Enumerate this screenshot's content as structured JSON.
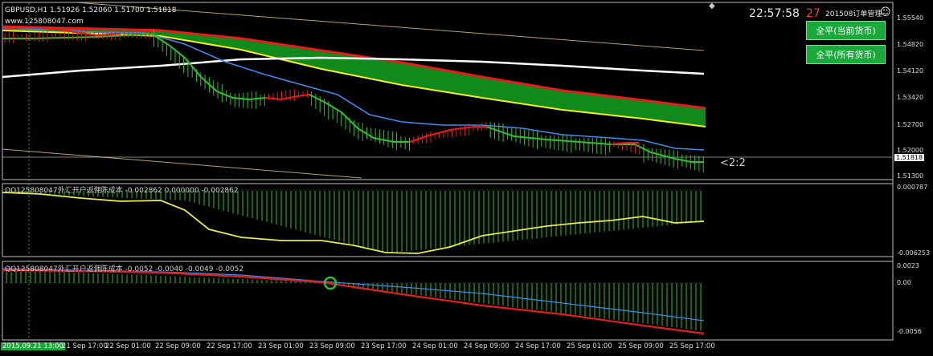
{
  "header": {
    "symbol_line": "GBPUSD,H1  1.51926 1.52060 1.51700 1.51818",
    "site": "www.125808047.com",
    "clock": "22:57:58",
    "seconds_left": "27",
    "brand": "201508订单管理",
    "collapse_glyph": "◆",
    "smiley_glyph": "☺"
  },
  "buttons": {
    "close_current": "全平(当前货币)",
    "close_all": "全平(所有货币)"
  },
  "main_chart": {
    "ratio_label": "<2:2",
    "price_axis": [
      "1.55540",
      "1.54820",
      "1.54120",
      "1.53420",
      "1.52700",
      "1.52000",
      "1.51300"
    ],
    "current_price": "1.51818"
  },
  "indicator1": {
    "label": "QQ125808047外汇开户返佣陈成本 -0.002862 0.000000 -0.002862",
    "axis": [
      "0.000787",
      "-0.006253"
    ]
  },
  "indicator2": {
    "label": "QQ125808047外汇开户返佣陈成本 -0.0052 -0.0040 -0.0049 -0.0052",
    "axis": [
      "0.0023",
      "0.00",
      "-0.0056"
    ]
  },
  "time_axis": [
    "2015.09.21 13:00",
    "21 Sep 17:00",
    "22 Sep 01:00",
    "22 Sep 09:00",
    "22 Sep 17:00",
    "23 Sep 01:00",
    "23 Sep 09:00",
    "23 Sep 17:00",
    "24 Sep 01:00",
    "24 Sep 09:00",
    "24 Sep 17:00",
    "25 Sep 01:00",
    "25 Sep 09:00",
    "25 Sep 17:00"
  ],
  "colors": {
    "background": "#000000",
    "frame": "#c0c0c0",
    "band_green": "#0f8a1b",
    "band_red": "#e81c1c",
    "band_yellow": "#f4f01e",
    "ma_white": "#ffffff",
    "ma_blue": "#3c8cf0",
    "ind_yellow": "#ecec40",
    "hist_green": "#2fc02f",
    "button": "#1aa83a",
    "accent_red": "#ff3c3c"
  }
}
